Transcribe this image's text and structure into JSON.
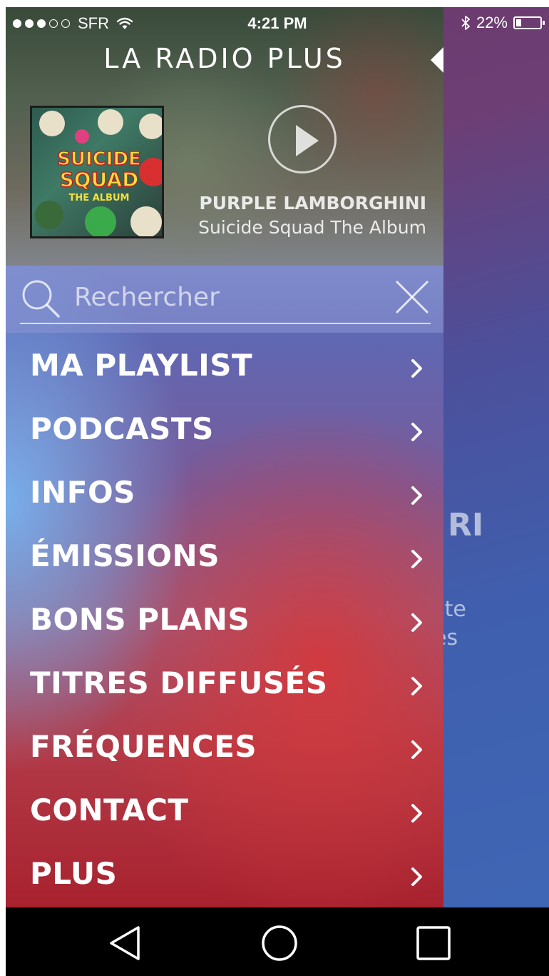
{
  "status_bar": {
    "carrier": "SFR",
    "signal_bars": 3,
    "time": "4:21 PM",
    "battery_percent_label": "22%",
    "battery_level": 0.22
  },
  "app": {
    "title": "LA RADIO PLUS"
  },
  "now_playing": {
    "album_art_text": [
      "SUICIDE",
      "SQUAD",
      "THE ALBUM"
    ],
    "title": "PURPLE LAMBORGHINI",
    "album": "Suicide Squad The Album"
  },
  "search": {
    "placeholder": "Rechercher",
    "value": ""
  },
  "menu": {
    "items": [
      {
        "label": "MA PLAYLIST"
      },
      {
        "label": "PODCASTS"
      },
      {
        "label": "INFOS"
      },
      {
        "label": "ÉMISSIONS"
      },
      {
        "label": "BONS PLANS"
      },
      {
        "label": "TITRES DIFFUSÉS"
      },
      {
        "label": "FRÉQUENCES"
      },
      {
        "label": "CONTACT"
      },
      {
        "label": "PLUS"
      }
    ]
  },
  "background_page": {
    "title_fragment": "RI",
    "line1_fragment": "ste",
    "line2_fragment": "es"
  },
  "icons": {
    "wifi": "wifi-icon",
    "bluetooth": "bluetooth-icon",
    "battery": "battery-icon",
    "collapse": "collapse-arrow-icon",
    "play": "play-icon",
    "search": "search-icon",
    "clear": "close-icon",
    "chevron": "chevron-right-icon",
    "nav_back": "back-icon",
    "nav_home": "home-icon",
    "nav_recents": "recents-icon"
  },
  "colors": {
    "menu_text": "#ffffff",
    "nav_bar": "#000000",
    "accent_red": "#b8232e",
    "accent_blue": "#4060b0"
  }
}
